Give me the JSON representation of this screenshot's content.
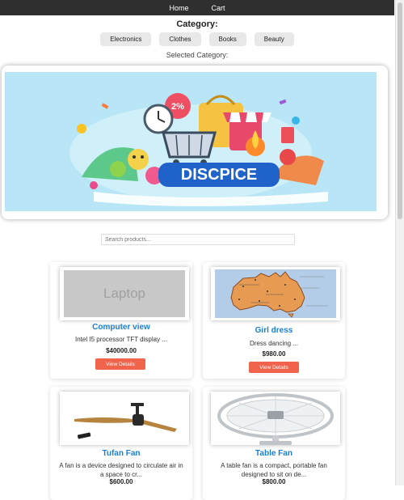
{
  "nav": {
    "home": "Home",
    "cart": "Cart"
  },
  "category": {
    "title": "Category:",
    "buttons": [
      "Electronics",
      "Clothes",
      "Books",
      "Beauty"
    ],
    "selected_label": "Selected Category:"
  },
  "banner": {
    "badge": "2%",
    "brand": "DISCPICE"
  },
  "search": {
    "placeholder": "Search products..."
  },
  "products": [
    {
      "name": "Computer view",
      "description": "Intel I5 processor TFT display ...",
      "price": "$40000.00",
      "button": "View Details",
      "image_text": "Laptop"
    },
    {
      "name": "Girl dress",
      "description": "Dress dancing ...",
      "price": "$980.00",
      "button": "View Details"
    },
    {
      "name": "Tufan Fan",
      "description": "A fan is a device designed to circulate air in a space to cr...",
      "price": "$600.00"
    },
    {
      "name": "Table Fan",
      "description": "A table fan is a compact, portable fan designed to sit on de...",
      "price": "$800.00"
    }
  ],
  "colors": {
    "nav": "#2f2f2f",
    "accent": "#1a7fd4",
    "button": "#f0644c"
  }
}
